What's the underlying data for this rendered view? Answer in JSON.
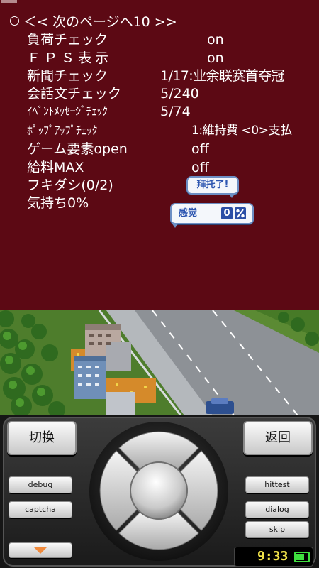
{
  "debug_menu": {
    "next_page": "＜< 次のページへ10 >>",
    "rows": [
      {
        "label": "負荷チェック",
        "value": "on"
      },
      {
        "label": "ＦＰＳ表示",
        "value": "on"
      },
      {
        "label": "新聞チェック",
        "value": "1/17:业余联赛首夺冠"
      },
      {
        "label": "会話文チェック",
        "value": "5/240"
      },
      {
        "label": "ｲﾍﾞﾝﾄﾒｯｾｰｼﾞﾁｪｯｸ",
        "value": "5/74"
      },
      {
        "label": "ﾎﾟｯﾌﾟｱｯﾌﾟﾁｪｯｸ",
        "value": "1:維持費 <0>支払"
      },
      {
        "label": "ゲーム要素open",
        "value": "off"
      },
      {
        "label": "給料MAX",
        "value": "off"
      },
      {
        "label": "フキダシ(0/2)",
        "value": ""
      },
      {
        "label": "気持ち0%",
        "value": ""
      }
    ]
  },
  "bubbles": {
    "request": "拜托了!",
    "feeling_label": "感觉",
    "feeling_value": "0"
  },
  "controls": {
    "switch_label": "切换",
    "back_label": "返回",
    "debug_label": "debug",
    "captcha_label": "captcha",
    "hittest_label": "hittest",
    "dialog_label": "dialog",
    "skip_label": "skip"
  },
  "status": {
    "time": "9:33",
    "battery_level": 0.7
  },
  "colors": {
    "debug_background": "#5c0914",
    "text": "#ffffff",
    "bubble_border": "#6d8fc4",
    "clock_text": "#f2e34a",
    "battery": "#3fe03f"
  }
}
